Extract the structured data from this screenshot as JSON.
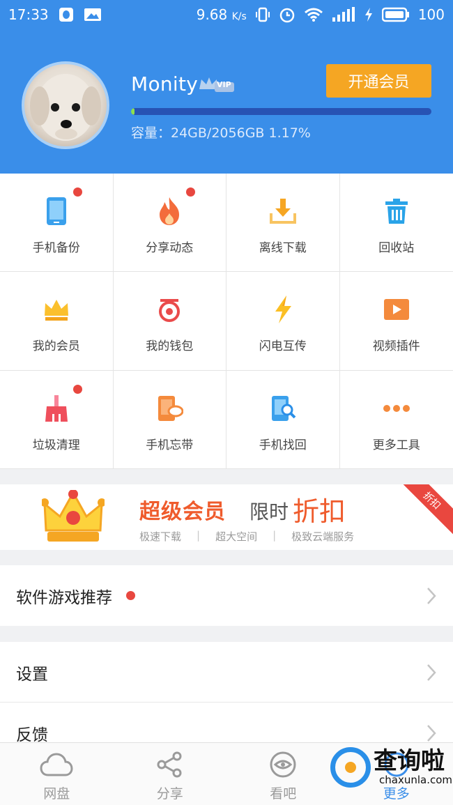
{
  "status_bar": {
    "time": "17:33",
    "speed": "9.68",
    "speed_unit": "K/s",
    "battery": "100"
  },
  "profile": {
    "username": "Monity",
    "vip_badge": "VIP",
    "open_vip_button": "开通会员",
    "capacity_text": "容量：24GB/2056GB 1.17%",
    "capacity_fraction": 0.0117
  },
  "tools": [
    {
      "label": "手机备份",
      "icon": "phone-backup-icon",
      "badge": true
    },
    {
      "label": "分享动态",
      "icon": "flame-icon",
      "badge": true
    },
    {
      "label": "离线下载",
      "icon": "download-tray-icon",
      "badge": false
    },
    {
      "label": "回收站",
      "icon": "trash-icon",
      "badge": false
    },
    {
      "label": "我的会员",
      "icon": "crown-icon",
      "badge": false
    },
    {
      "label": "我的钱包",
      "icon": "wallet-icon",
      "badge": false
    },
    {
      "label": "闪电互传",
      "icon": "lightning-icon",
      "badge": false
    },
    {
      "label": "视频插件",
      "icon": "video-play-icon",
      "badge": false
    },
    {
      "label": "垃圾清理",
      "icon": "broom-icon",
      "badge": true
    },
    {
      "label": "手机忘带",
      "icon": "phone-cloud-icon",
      "badge": false
    },
    {
      "label": "手机找回",
      "icon": "phone-search-icon",
      "badge": false
    },
    {
      "label": "更多工具",
      "icon": "more-dots-icon",
      "badge": false
    }
  ],
  "banner": {
    "title": "超级会员",
    "limited": "限时",
    "discount": "折扣",
    "features": [
      "极速下载",
      "超大空间",
      "极致云端服务"
    ],
    "ribbon": "折扣"
  },
  "menu": {
    "recommend": "软件游戏推荐",
    "settings": "设置",
    "feedback": "反馈"
  },
  "bottom_nav": [
    {
      "label": "网盘",
      "icon": "cloud-icon"
    },
    {
      "label": "分享",
      "icon": "share-icon"
    },
    {
      "label": "看吧",
      "icon": "eye-icon"
    },
    {
      "label": "更多",
      "icon": "more-icon"
    }
  ],
  "watermark": {
    "main": "查询啦",
    "sub": "chaxunla.com"
  },
  "colors": {
    "header_blue": "#3a8ee9",
    "accent_orange": "#f5a623",
    "badge_red": "#e8473f"
  }
}
